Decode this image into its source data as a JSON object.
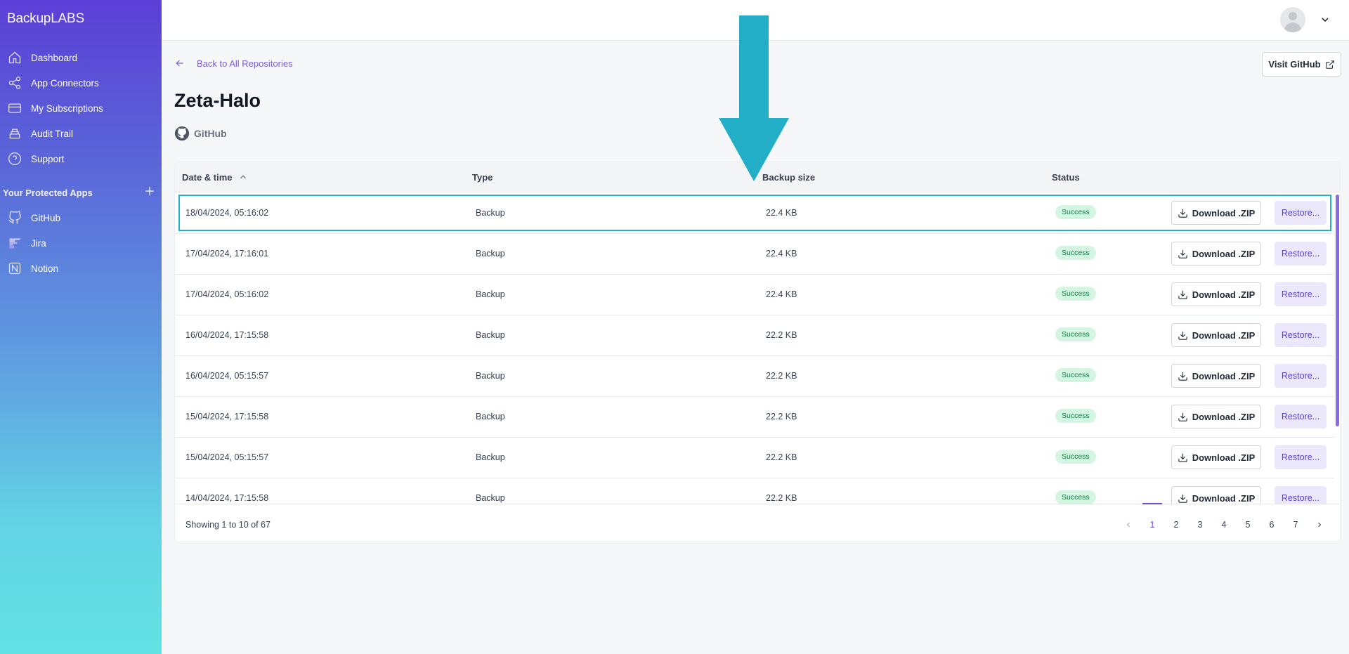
{
  "brand": {
    "part1": "Backup",
    "part2": "LABS"
  },
  "sidebar": {
    "nav": [
      {
        "label": "Dashboard",
        "icon": "home-icon"
      },
      {
        "label": "App Connectors",
        "icon": "share-icon"
      },
      {
        "label": "My Subscriptions",
        "icon": "card-icon"
      },
      {
        "label": "Audit Trail",
        "icon": "stack-icon"
      },
      {
        "label": "Support",
        "icon": "help-icon"
      }
    ],
    "section_title": "Your Protected Apps",
    "apps": [
      {
        "label": "GitHub",
        "icon": "github-icon"
      },
      {
        "label": "Jira",
        "icon": "jira-icon"
      },
      {
        "label": "Notion",
        "icon": "notion-icon"
      }
    ]
  },
  "header": {
    "back_label": "Back to All Repositories",
    "visit_label": "Visit GitHub",
    "title": "Zeta-Halo",
    "provider": "GitHub"
  },
  "table": {
    "columns": {
      "date": "Date & time",
      "type": "Type",
      "size": "Backup size",
      "status": "Status"
    },
    "download_label": "Download .ZIP",
    "restore_label": "Restore...",
    "rows": [
      {
        "date": "18/04/2024, 05:16:02",
        "type": "Backup",
        "size": "22.4 KB",
        "status": "Success"
      },
      {
        "date": "17/04/2024, 17:16:01",
        "type": "Backup",
        "size": "22.4 KB",
        "status": "Success"
      },
      {
        "date": "17/04/2024, 05:16:02",
        "type": "Backup",
        "size": "22.4 KB",
        "status": "Success"
      },
      {
        "date": "16/04/2024, 17:15:58",
        "type": "Backup",
        "size": "22.2 KB",
        "status": "Success"
      },
      {
        "date": "16/04/2024, 05:15:57",
        "type": "Backup",
        "size": "22.2 KB",
        "status": "Success"
      },
      {
        "date": "15/04/2024, 17:15:58",
        "type": "Backup",
        "size": "22.2 KB",
        "status": "Success"
      },
      {
        "date": "15/04/2024, 05:15:57",
        "type": "Backup",
        "size": "22.2 KB",
        "status": "Success"
      },
      {
        "date": "14/04/2024, 17:15:58",
        "type": "Backup",
        "size": "22.2 KB",
        "status": "Success"
      }
    ],
    "showing": "Showing 1 to 10 of 67",
    "pages": [
      "1",
      "2",
      "3",
      "4",
      "5",
      "6",
      "7"
    ],
    "current_page": "1"
  },
  "colors": {
    "accent": "#6d4be0",
    "highlight": "#22b0c9",
    "success_bg": "#d5f5e3",
    "success_text": "#0f7a44"
  }
}
